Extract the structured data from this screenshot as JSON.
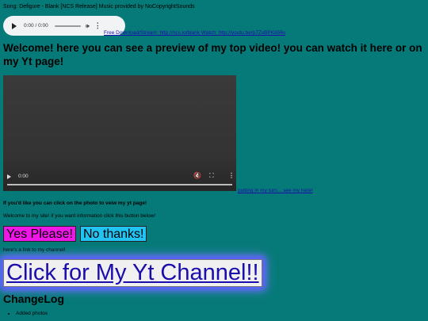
{
  "song_line": "Song: Defigure - Blank [NCS Release] Music provided by NoCopyrightSounds",
  "audio": {
    "time": "0:00 / 0:00"
  },
  "download_link": "Free Download/Stream: http://ncs.io/blank Watch: http://youtu.be/p7ZsBPK656s",
  "heading": "Welcome! here you can see a preview of my top video! you can watch it here or on my Yt page!",
  "video": {
    "time": "0:00"
  },
  "image_link": "putting in my turn... see my here!",
  "click_photo_text": "If you'd like you can click on the photo to veiw my yt page!",
  "welcome_text": "Welcome to my site! if you want information click this button below!",
  "buttons": {
    "yes": "Yes Please!",
    "no": "No thanks!"
  },
  "heres_text": "here's a link to my channel!",
  "channel_link": "Click for My Yt Channel!!",
  "changelog": {
    "title": "ChangeLog",
    "items": [
      "Added photos"
    ]
  },
  "colors": {
    "background": "#067a78",
    "yes_button": "#ef17e8",
    "no_button": "#21c3f3",
    "glow": "#5a5cff"
  }
}
